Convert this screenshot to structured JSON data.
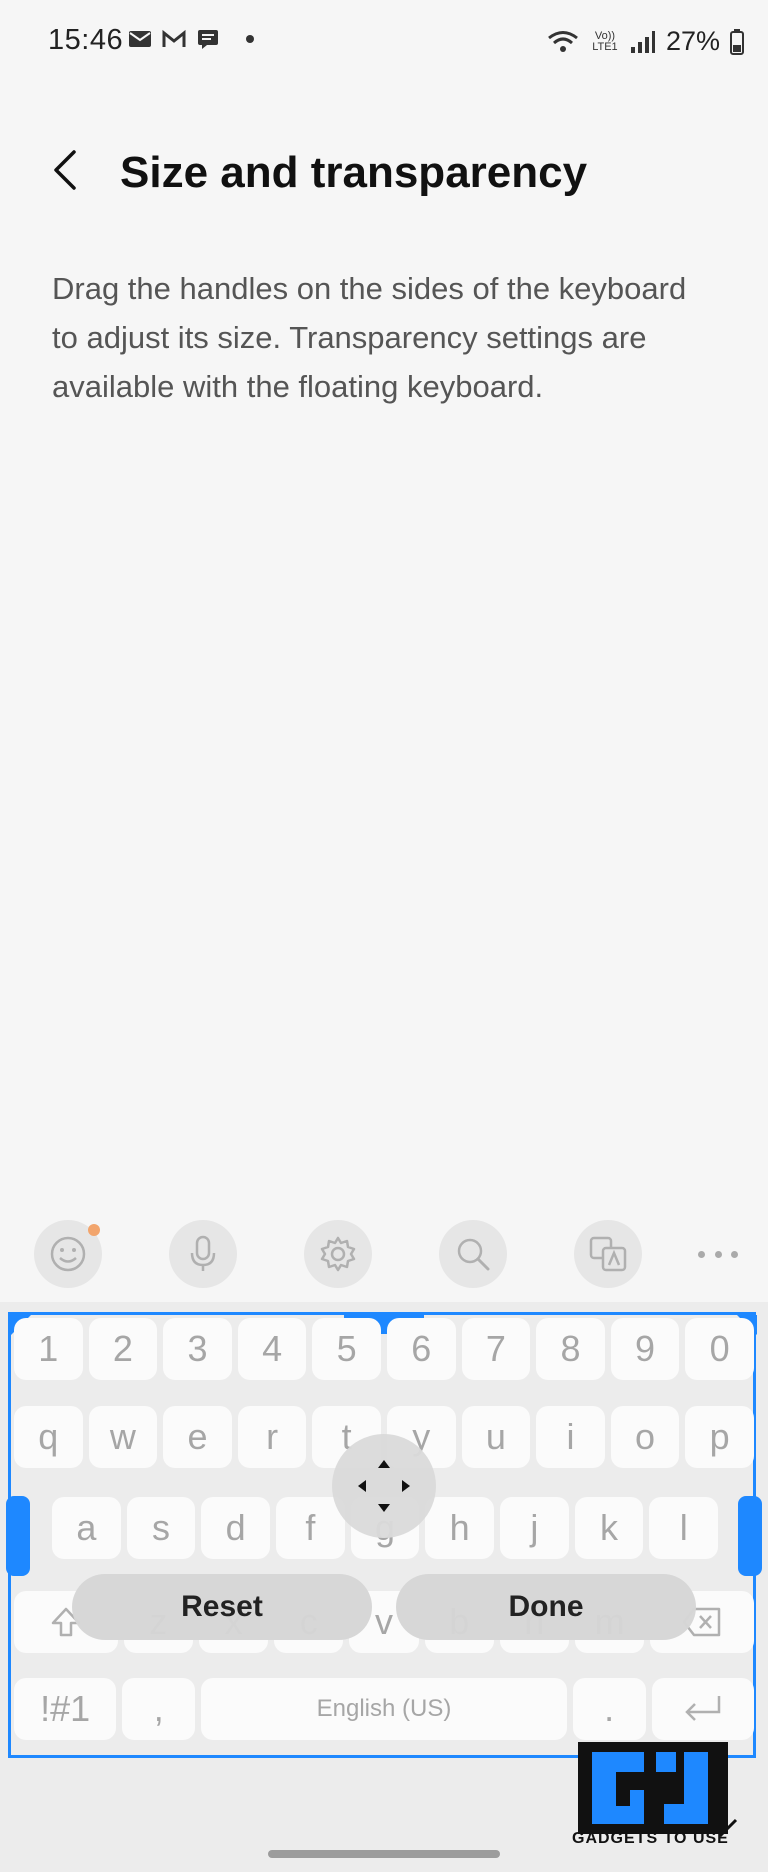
{
  "status_bar": {
    "time": "15:46",
    "network_label": "Vo)) LTE1",
    "battery": "27%"
  },
  "header": {
    "title": "Size and transparency"
  },
  "description": "Drag the handles on the sides of the keyboard to adjust its size. Transparency settings are available with the floating keyboard.",
  "toolbar": {
    "icons": [
      "emoji-icon",
      "mic-icon",
      "settings-icon",
      "search-icon",
      "translate-icon",
      "more-icon"
    ]
  },
  "keyboard": {
    "number_row": [
      "1",
      "2",
      "3",
      "4",
      "5",
      "6",
      "7",
      "8",
      "9",
      "0"
    ],
    "row1": [
      "q",
      "w",
      "e",
      "r",
      "t",
      "y",
      "u",
      "i",
      "o",
      "p"
    ],
    "row2": [
      "a",
      "s",
      "d",
      "f",
      "g",
      "h",
      "j",
      "k",
      "l"
    ],
    "row3": [
      "z",
      "x",
      "c",
      "v",
      "b",
      "n",
      "m"
    ],
    "symbols_key": "!#1",
    "comma_key": ",",
    "space_label": "English (US)",
    "period_key": "."
  },
  "buttons": {
    "reset": "Reset",
    "done": "Done"
  },
  "watermark": {
    "text": "GADGETS TO USE"
  },
  "colors": {
    "accent": "#1e88ff"
  }
}
